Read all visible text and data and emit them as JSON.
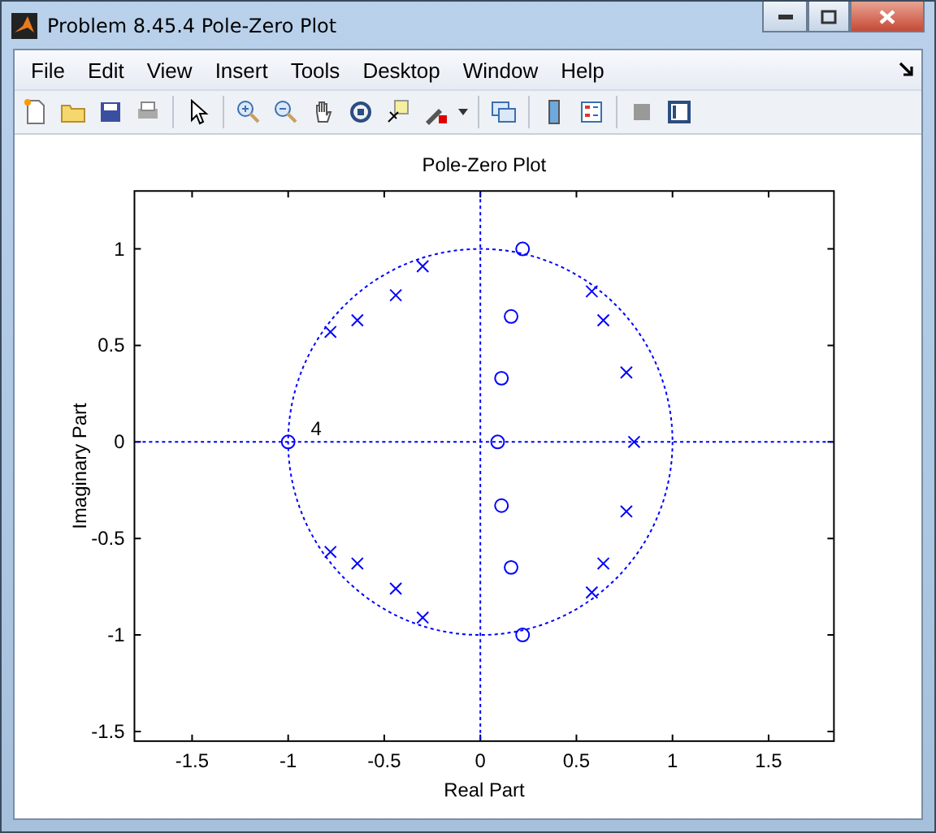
{
  "window": {
    "title": "Problem 8.45.4 Pole-Zero Plot"
  },
  "menu": [
    "File",
    "Edit",
    "View",
    "Insert",
    "Tools",
    "Desktop",
    "Window",
    "Help"
  ],
  "figure": {
    "chart_data": {
      "type": "scatter",
      "title": "Pole-Zero Plot",
      "xlabel": "Real Part",
      "ylabel": "Imaginary Part",
      "xlim": [
        -1.8,
        1.84
      ],
      "ylim": [
        -1.55,
        1.3
      ],
      "xticks": [
        -1.5,
        -1,
        -0.5,
        0,
        0.5,
        1,
        1.5
      ],
      "yticks": [
        -1.5,
        -1,
        -0.5,
        0,
        0.5,
        1
      ],
      "series": [
        {
          "color": "#0000ff",
          "marker": "o",
          "x": [
            0.22,
            0.16,
            0.11,
            0.09,
            0.11,
            0.16,
            0.22,
            -1
          ],
          "values": [
            1.0,
            0.65,
            0.33,
            0,
            -0.33,
            -0.65,
            -1.0,
            0
          ]
        },
        {
          "color": "#0000ff",
          "marker": "x",
          "x": [
            -0.3,
            -0.44,
            -0.64,
            -0.78,
            0.58,
            0.64,
            0.76,
            0.8,
            -0.3,
            -0.44,
            -0.64,
            -0.78,
            0.58,
            0.64,
            0.76
          ],
          "values": [
            0.91,
            0.76,
            0.63,
            0.57,
            0.78,
            0.63,
            0.36,
            0,
            -0.91,
            -0.76,
            -0.63,
            -0.57,
            -0.78,
            -0.63,
            -0.36
          ]
        }
      ],
      "annotations": [
        "4"
      ]
    }
  }
}
